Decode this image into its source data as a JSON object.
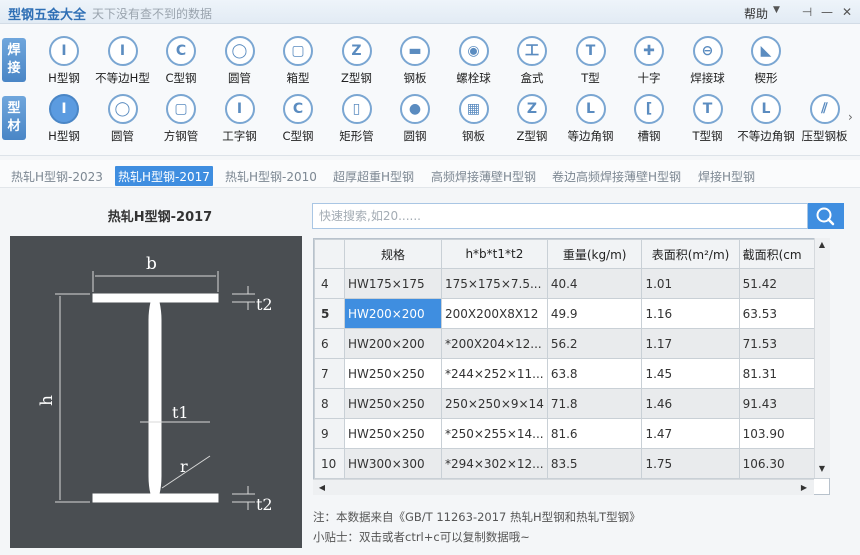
{
  "app": {
    "title": "型钢五金大全",
    "slogan": "天下没有查不到的数据",
    "help": "帮助",
    "help_arrow": "▼",
    "win_pin": "⊣",
    "win_min": "—",
    "win_close": "✕"
  },
  "toolbar": {
    "categories": [
      {
        "label": "焊\n接"
      },
      {
        "label": "型\n材"
      }
    ],
    "row1": [
      {
        "label": "H型钢",
        "icon": "I"
      },
      {
        "label": "不等边H型",
        "icon": "I"
      },
      {
        "label": "C型钢",
        "icon": "C"
      },
      {
        "label": "圆管",
        "icon": "◯"
      },
      {
        "label": "箱型",
        "icon": "▢"
      },
      {
        "label": "Z型钢",
        "icon": "Z"
      },
      {
        "label": "钢板",
        "icon": "▬"
      },
      {
        "label": "螺栓球",
        "icon": "◉"
      },
      {
        "label": "盒式",
        "icon": "工"
      },
      {
        "label": "T型",
        "icon": "T"
      },
      {
        "label": "十字",
        "icon": "✚"
      },
      {
        "label": "焊接球",
        "icon": "⊖"
      },
      {
        "label": "楔形",
        "icon": "◣"
      }
    ],
    "row2": [
      {
        "label": "H型钢",
        "icon": "I"
      },
      {
        "label": "圆管",
        "icon": "◯"
      },
      {
        "label": "方钢管",
        "icon": "▢"
      },
      {
        "label": "工字钢",
        "icon": "I"
      },
      {
        "label": "C型钢",
        "icon": "C"
      },
      {
        "label": "矩形管",
        "icon": "▯"
      },
      {
        "label": "圆钢",
        "icon": "●"
      },
      {
        "label": "钢板",
        "icon": "▦"
      },
      {
        "label": "Z型钢",
        "icon": "Z"
      },
      {
        "label": "等边角钢",
        "icon": "L"
      },
      {
        "label": "槽钢",
        "icon": "["
      },
      {
        "label": "T型钢",
        "icon": "T"
      },
      {
        "label": "不等边角钢",
        "icon": "L"
      },
      {
        "label": "压型钢板",
        "icon": "⫽"
      }
    ],
    "more": "›"
  },
  "subtabs": [
    {
      "label": "热轧H型钢-2023"
    },
    {
      "label": "热轧H型钢-2017",
      "active": true
    },
    {
      "label": "热轧H型钢-2010"
    },
    {
      "label": "超厚超重H型钢"
    },
    {
      "label": "高频焊接薄壁H型钢"
    },
    {
      "label": "卷边高频焊接薄壁H型钢"
    },
    {
      "label": "焊接H型钢"
    }
  ],
  "section_title": "热轧H型钢-2017",
  "diagram": {
    "label_b": "b",
    "label_h": "h",
    "label_t1": "t1",
    "label_t2_top": "t2",
    "label_t2_bottom": "t2",
    "label_r": "r"
  },
  "search": {
    "placeholder": "快速搜索,如20......"
  },
  "table": {
    "headers": [
      "规格",
      "h*b*t1*t2",
      "重量(kg/m)",
      "表面积(m²/m)",
      "截面积(cm"
    ],
    "rows": [
      {
        "idx": "4",
        "cells": [
          "HW175×175",
          "175×175×7.5...",
          "40.4",
          "1.01",
          "51.42"
        ]
      },
      {
        "idx": "5",
        "cells": [
          "HW200×200",
          "200X200X8X12",
          "49.9",
          "1.16",
          "63.53"
        ],
        "current": true,
        "selected_col": 0
      },
      {
        "idx": "6",
        "cells": [
          "HW200×200",
          "*200X204×12...",
          "56.2",
          "1.17",
          "71.53"
        ]
      },
      {
        "idx": "7",
        "cells": [
          "HW250×250",
          "*244×252×11...",
          "63.8",
          "1.45",
          "81.31"
        ]
      },
      {
        "idx": "8",
        "cells": [
          "HW250×250",
          "250×250×9×14",
          "71.8",
          "1.46",
          "91.43"
        ]
      },
      {
        "idx": "9",
        "cells": [
          "HW250×250",
          "*250×255×14...",
          "81.6",
          "1.47",
          "103.90"
        ]
      },
      {
        "idx": "10",
        "cells": [
          "HW300×300",
          "*294×302×12...",
          "83.5",
          "1.75",
          "106.30"
        ]
      }
    ]
  },
  "note": "注：本数据来自《GB/T 11263-2017 热轧H型钢和热轧T型钢》",
  "tip": "小贴士：双击或者ctrl+c可以复制数据哦~"
}
